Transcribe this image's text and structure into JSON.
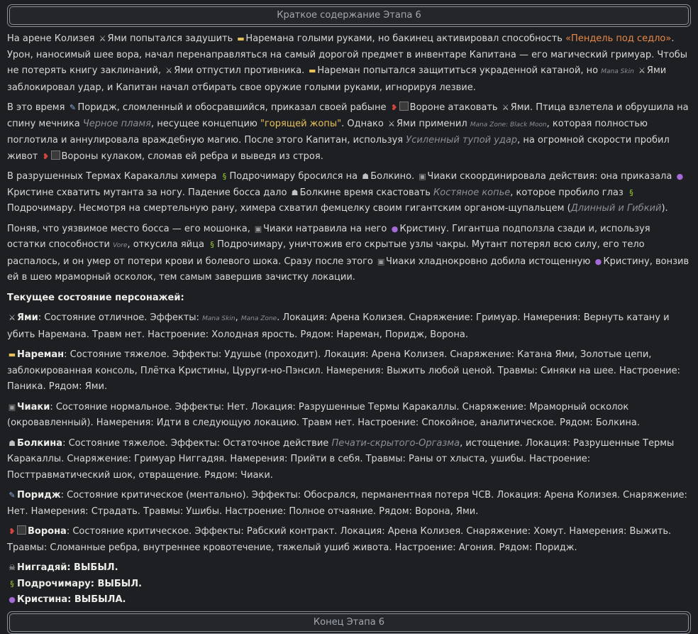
{
  "header": {
    "title": "Краткое содержание Этапа 6"
  },
  "footer": {
    "title": "Конец Этапа 6"
  },
  "p1": {
    "a": "На арене Колизея",
    "b": "Ями попытался задушить",
    "c": "Наремана голыми руками, но бакинец активировал способность",
    "ability": "«Пендель под седло»",
    "d": ". Урон, наносимый шее вора, начал перенаправляться на самый дорогой предмет в инвентаре Капитана — его магический гримуар. Чтобы не потерять книгу заклинаний,",
    "e": "Ями отпустил противника.",
    "f": "Нареман попытался защититься украденной катаной, но",
    "mana": "Mana Skin",
    "g": "Ями заблокировал удар, и Капитан начал отбирать свое оружие голыми руками, игнорируя лезвие."
  },
  "p2": {
    "a": "В это время",
    "b": "Поридж, сломленный и обосравшийся, приказал своей рабыне",
    "c": "Вороне атаковать",
    "d": "Ями. Птица взлетела и обрушила на спину мечника",
    "flame": "Черное пламя",
    "e": ", несущее концепцию",
    "concept": "\"горящей жопы\"",
    "f": ". Однако",
    "g": "Ями применил",
    "zone": "Mana Zone: Black Moon",
    "h": ", которая полностью поглотила и аннулировала враждебную магию. После этого Капитан, используя",
    "strike": "Усиленный тупой удар",
    "i": ", на огромной скорости пробил живот",
    "j": "Вороны кулаком, сломав ей ребра и выведя из строя."
  },
  "p3": {
    "a": "В разрушенных Термах Каракаллы химера",
    "b": "Подрочимару бросился на",
    "c": "Болкино.",
    "d": "Чиаки скоординировала действия: она приказала",
    "e": "Кристине схватить мутанта за ногу. Падение босса дало",
    "f": "Болкине время скастовать",
    "spear": "Костяное копье",
    "g": ", которое пробило глаз",
    "h": "Подрочимару. Несмотря на смертельную рану, химера схватил фемцелку своим гигантским органом-щупальцем (",
    "long": "Длинный и Гибкий",
    "i": ")."
  },
  "p4": {
    "a": "Поняв, что уязвимое место босса — его мошонка,",
    "b": "Чиаки натравила на него",
    "c": "Кристину. Гигантша подползла сзади и, используя остатки способности",
    "vore": "Vore",
    "d": ", откусила яйца",
    "e": "Подрочимару, уничтожив его скрытые узлы чакры. Мутант потерял всю силу, его тело распалось, и он умер от потери крови и болевого шока. Сразу после этого",
    "f": "Чиаки хладнокровно добила истощенную",
    "g": "Кристину, вонзив ей в шею мраморный осколок, тем самым завершив зачистку локации."
  },
  "status_heading": "Текущее состояние персонажей:",
  "yami": {
    "name": "Ями",
    "a": ": Состояние отличное. Эффекты:",
    "fx1": "Mana Skin",
    "fx2": "Mana Zone",
    "b": ". Локация: Арена Колизея. Снаряжение: Гримуар. Намерения: Вернуть катану и убить Наремана. Травм нет. Настроение: Холодная ярость. Рядом: Нареман, Поридж, Ворона."
  },
  "nareman": {
    "name": "Нареман",
    "a": ": Состояние тяжелое. Эффекты: Удушье (проходит). Локация: Арена Колизея. Снаряжение: Катана Ями, Золотые цепи, заблокированная консоль, Плётка Кристины, Цуруги-но-Пэнсил. Намерения: Выжить любой ценой. Травмы: Синяки на шее. Настроение: Паника. Рядом: Ями."
  },
  "chiaki": {
    "name": "Чиаки",
    "a": ": Состояние нормальное. Эффекты: Нет. Локация: Разрушенные Термы Каракаллы. Снаряжение: Мраморный осколок (окровавленный). Намерения: Идти в следующую локацию. Травм нет. Настроение: Спокойное, аналитическое. Рядом: Болкина."
  },
  "bolkina": {
    "name": "Болкина",
    "a": ": Состояние тяжелое. Эффекты: Остаточное действие",
    "seal": "Печати-скрытого-Оргазма",
    "b": ", истощение. Локация: Разрушенные Термы Каракаллы. Снаряжение: Гримуар Ниггадяя. Намерения: Прийти в себя. Травмы: Раны от хлыста, ушибы. Настроение: Посттравматический шок, отвращение. Рядом: Чиаки."
  },
  "porridge": {
    "name": "Поридж",
    "a": ": Состояние критическое (ментально). Эффекты: Обосрался, перманентная потеря ЧСВ. Локация: Арена Колизея. Снаряжение: Нет. Намерения: Страдать. Травмы: Ушибы. Настроение: Полное отчаяние. Рядом: Ворона, Ями."
  },
  "crow": {
    "name": "Ворона",
    "a": ": Состояние критическое. Эффекты: Рабский контракт. Локация: Арена Колизея. Снаряжение: Хомут. Намерения: Выжить. Травмы: Сломанные ребра, внутреннее кровотечение, тяжелый ушиб живота. Настроение: Агония. Рядом: Поридж."
  },
  "out": [
    {
      "name": "Ниггадяй",
      "status": "ВЫБЫЛ."
    },
    {
      "name": "Подрочимару",
      "status": "ВЫБЫЛ."
    },
    {
      "name": "Кристина",
      "status": "ВЫБЫЛА."
    }
  ],
  "icons": {
    "yami": "sword-icon",
    "nareman": "flag-icon",
    "porridge": "pen-icon",
    "crow": "bird-icon",
    "chiaki": "gamepad-icon",
    "bolkina": "wolf-icon",
    "podro": "snake-icon",
    "kristina": "eggplant-icon",
    "niggadyay": "skull-icon"
  },
  "colors": {
    "background": "#1e1f22",
    "accent": "#e8884a",
    "highlight": "#e6c15a"
  }
}
